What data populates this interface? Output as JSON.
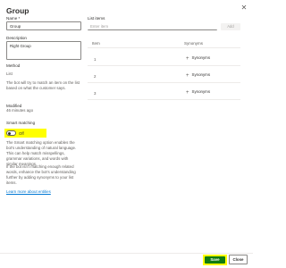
{
  "header": {
    "title": "Group",
    "close_icon": "close-icon"
  },
  "name_field": {
    "label": "Name *",
    "value": "Group"
  },
  "description_field": {
    "label": "Description",
    "value": "Right Group"
  },
  "method": {
    "label": "Method",
    "value": "List",
    "help": "The bot will try to match an item on the list based on what the customer says."
  },
  "modified": {
    "label": "Modified",
    "value": "46 minutes ago"
  },
  "smart_matching": {
    "label": "Smart matching",
    "toggle_state": "Off",
    "description_1": "The Smart matching option enables the bot's understanding of natural language. This can help match misspellings, grammar variations, and words with similar meanings.",
    "description_2": "If the bot isn't matching enough related words, enhance the bot's understanding further by adding synonyms to your list items.",
    "learn_more": "Learn more about entities"
  },
  "list_items": {
    "label": "List items",
    "input_placeholder": "Enter item",
    "add_label": "Add",
    "col_item": "Item",
    "col_synonyms": "Synonyms",
    "rows": [
      {
        "item": "1",
        "synonyms_label": "Synonyms"
      },
      {
        "item": "2",
        "synonyms_label": "Synonyms"
      },
      {
        "item": "3",
        "synonyms_label": "Synonyms"
      }
    ]
  },
  "footer": {
    "save_label": "Save",
    "close_label": "Close"
  },
  "colors": {
    "save_bg": "#107c10",
    "highlight": "#ffff00",
    "link": "#0078d4"
  }
}
